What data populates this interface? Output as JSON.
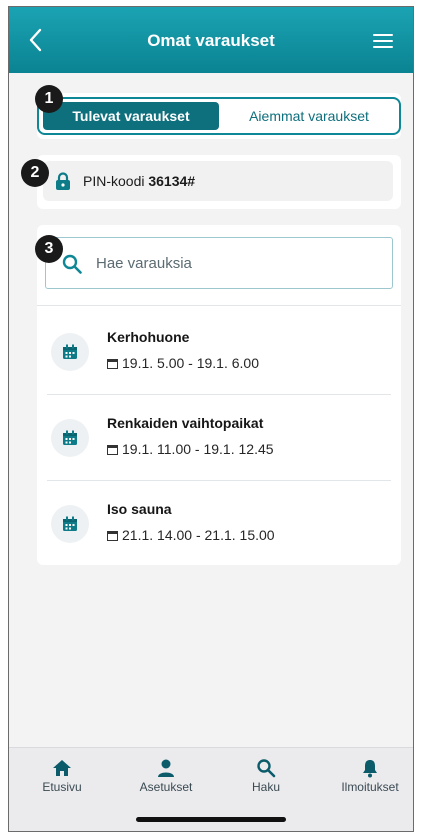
{
  "header": {
    "title": "Omat varaukset"
  },
  "tabs": {
    "upcoming": "Tulevat varaukset",
    "past": "Aiemmat varaukset"
  },
  "pin": {
    "label": "PIN-koodi",
    "code": "36134#"
  },
  "search": {
    "placeholder": "Hae varauksia"
  },
  "reservations": [
    {
      "name": "Kerhohuone",
      "time": "19.1. 5.00 - 19.1. 6.00"
    },
    {
      "name": "Renkaiden vaihtopaikat",
      "time": "19.1. 11.00 - 19.1. 12.45"
    },
    {
      "name": "Iso sauna",
      "time": "21.1. 14.00 - 21.1. 15.00"
    }
  ],
  "badges": [
    "1",
    "2",
    "3"
  ],
  "nav": {
    "home": "Etusivu",
    "settings": "Asetukset",
    "search": "Haku",
    "notifications": "Ilmoitukset"
  },
  "colors": {
    "accent": "#0e8896",
    "accent_dark": "#0e6f7d",
    "background": "#f3f3f4"
  }
}
